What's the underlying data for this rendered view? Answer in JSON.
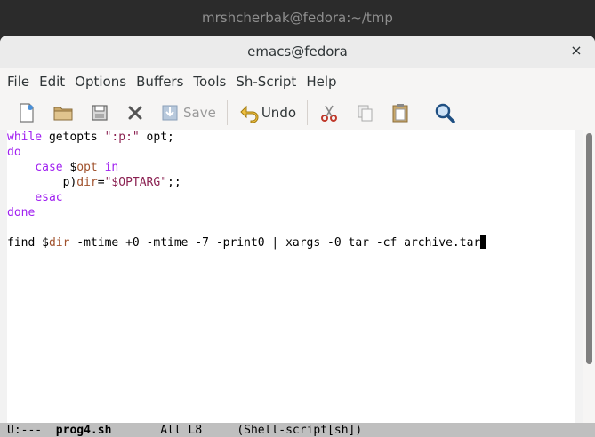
{
  "outer_title": "mrshcherbak@fedora:~/tmp",
  "window": {
    "title": "emacs@fedora",
    "close_glyph": "×"
  },
  "menubar": [
    "File",
    "Edit",
    "Options",
    "Buffers",
    "Tools",
    "Sh-Script",
    "Help"
  ],
  "toolbar": {
    "new_icon": "new-file-icon",
    "open_icon": "open-folder-icon",
    "save_icon_disk": "disk-icon",
    "close_icon": "close-x-icon",
    "save_label": "Save",
    "undo_label": "Undo",
    "cut_icon": "scissors-icon",
    "copy_icon": "copy-icon",
    "paste_icon": "paste-icon",
    "search_icon": "search-icon"
  },
  "code": {
    "l1_kw": "while",
    "l1_rest1": " getopts ",
    "l1_str": "\":p:\"",
    "l1_rest2": " opt;",
    "l2_kw": "do",
    "l3_indent": "    ",
    "l3_kw": "case",
    "l3_sp": " $",
    "l3_var": "opt",
    "l3_sp2": " ",
    "l3_kw2": "in",
    "l4_indent": "        p)",
    "l4_var": "dir",
    "l4_eq": "=",
    "l4_str": "\"$OPTARG\"",
    "l4_rest": ";;",
    "l5_indent": "    ",
    "l5_kw": "esac",
    "l6_kw": "done",
    "l8_a": "find $",
    "l8_var": "dir",
    "l8_b": " -mtime +0 -mtime -7 -print0 | xargs -0 tar -cf archive.tar"
  },
  "modeline": {
    "status": "U:---  ",
    "buffer": "prog4.sh",
    "position": "       All L8     ",
    "mode": "(Shell-script[sh])"
  },
  "colors": {
    "keyword": "#a020f0",
    "variable": "#a0522d",
    "string": "#8b2252"
  }
}
